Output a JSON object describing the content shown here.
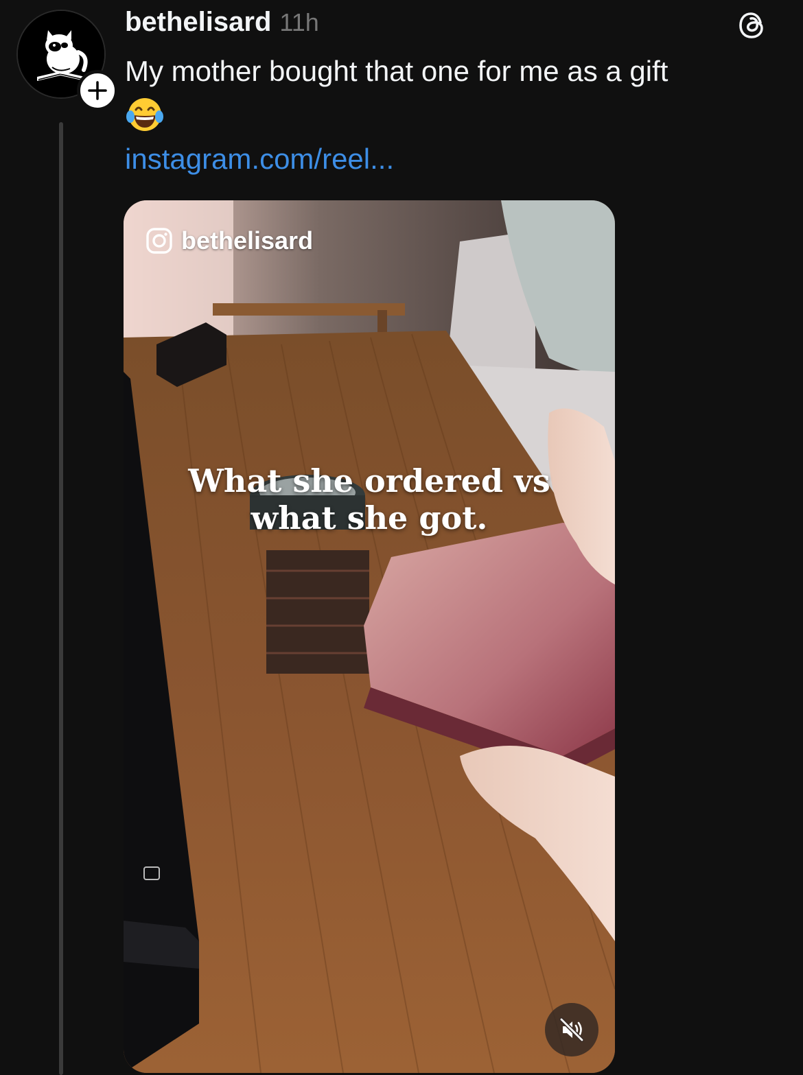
{
  "post": {
    "username": "bethelisard",
    "timestamp": "11h",
    "text": "My mother bought that one for me as a gift",
    "emoji": "😂",
    "link_text": "instagram.com/reel..."
  },
  "media": {
    "watermark_username": "bethelisard",
    "caption": "What she ordered vs what she got.",
    "muted": true
  },
  "icons": {
    "avatar": "cat-avatar-icon",
    "follow": "plus-icon",
    "app": "threads-logo-icon",
    "watermark": "instagram-icon",
    "mute": "speaker-muted-icon"
  },
  "colors": {
    "background": "#101010",
    "link": "#3d8ee6",
    "timestamp": "#777777",
    "thread_line": "#3a3a3a"
  }
}
